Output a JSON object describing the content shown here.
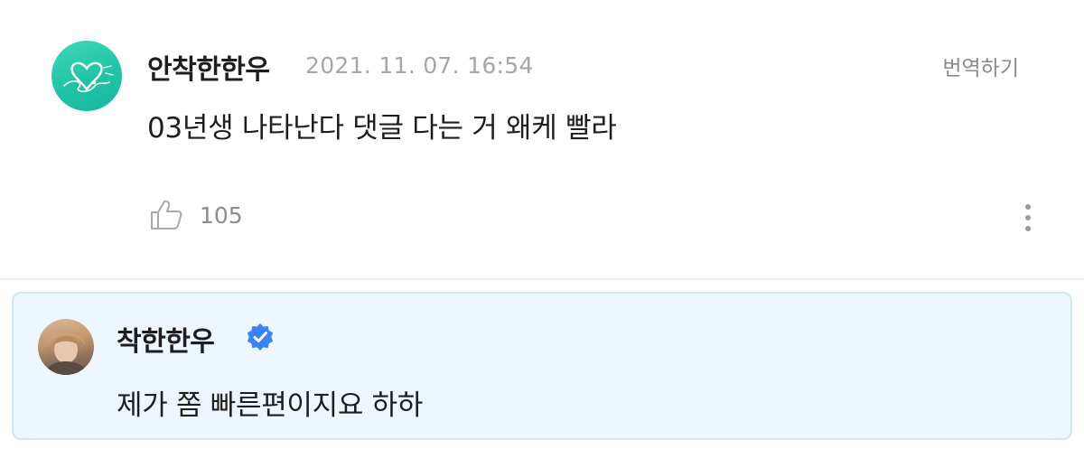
{
  "comment": {
    "author": "안착한한우",
    "timestamp": "2021. 11. 07. 16:54",
    "translate_label": "번역하기",
    "text": "03년생 나타난다 댓글 다는 거 왜케 빨라",
    "like_count": "105",
    "avatar_color": "#21c3a7",
    "icons": [
      "thumbs-up-icon",
      "more-vertical-icon"
    ]
  },
  "reply": {
    "author": "착한한우",
    "text": "제가 쫌 빠른편이지요 하하",
    "verified_color": "#3b82f6",
    "background_color": "#eef7ff",
    "border_color": "#cfe6f8",
    "icons": [
      "verified-badge-icon"
    ]
  }
}
